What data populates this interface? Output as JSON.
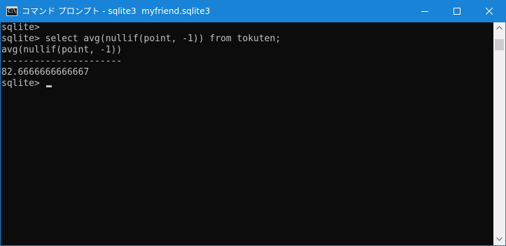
{
  "window": {
    "title": "コマンド プロンプト - sqlite3  myfriend.sqlite3",
    "icon": "cmd-icon",
    "icon_text": "C:\\.",
    "buttons": {
      "minimize": "minimize-icon",
      "maximize": "maximize-icon",
      "close": "close-icon"
    }
  },
  "console": {
    "lines": [
      "sqlite>",
      "sqlite> select avg(nullif(point, -1)) from tokuten;",
      "avg(nullif(point, -1))",
      "----------------------",
      "82.6666666666667"
    ],
    "prompt": "sqlite>"
  },
  "colors": {
    "titlebar": "#1883d7",
    "console_bg": "#0c0c0c",
    "console_fg": "#c0c0c0",
    "scrollbar": "#f0f0f0"
  }
}
